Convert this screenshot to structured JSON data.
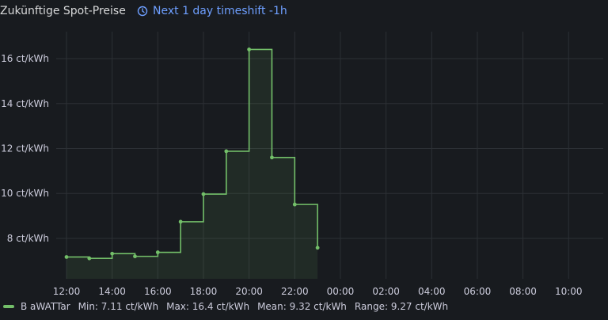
{
  "panel": {
    "title": "Zukünftige Spot-Preise",
    "timeshift_label": "Next 1 day timeshift -1h"
  },
  "colors": {
    "series": "#73bf69",
    "accent": "#6e9fff",
    "background": "#181b1f",
    "grid": "#2c3035"
  },
  "legend": {
    "series_name": "B aWATTar",
    "min": "Min: 7.11 ct/kWh",
    "max": "Max: 16.4 ct/kWh",
    "mean": "Mean: 9.32 ct/kWh",
    "range": "Range: 9.27 ct/kWh"
  },
  "chart_data": {
    "type": "line",
    "interpolation": "step-after",
    "fill": true,
    "x_unit": "hour of day",
    "x": [
      12,
      13,
      14,
      15,
      16,
      17,
      18,
      19,
      20,
      21,
      22,
      23
    ],
    "series": [
      {
        "name": "B aWATTar",
        "values": [
          7.17,
          7.11,
          7.32,
          7.2,
          7.38,
          8.74,
          9.97,
          11.88,
          16.41,
          11.6,
          9.51,
          7.58
        ]
      }
    ],
    "xlim": [
      12,
      23.5
    ],
    "x_ticks": [
      "12:00",
      "14:00",
      "16:00",
      "18:00",
      "20:00",
      "22:00",
      "00:00",
      "02:00",
      "04:00",
      "06:00",
      "08:00",
      "10:00"
    ],
    "ylim": [
      6.2,
      17.2
    ],
    "y_ticks": [
      8,
      10,
      12,
      14,
      16
    ],
    "y_tick_labels": [
      "8 ct/kWh",
      "10 ct/kWh",
      "12 ct/kWh",
      "14 ct/kWh",
      "16 ct/kWh"
    ],
    "grid": true,
    "legend_position": "bottom-left"
  }
}
